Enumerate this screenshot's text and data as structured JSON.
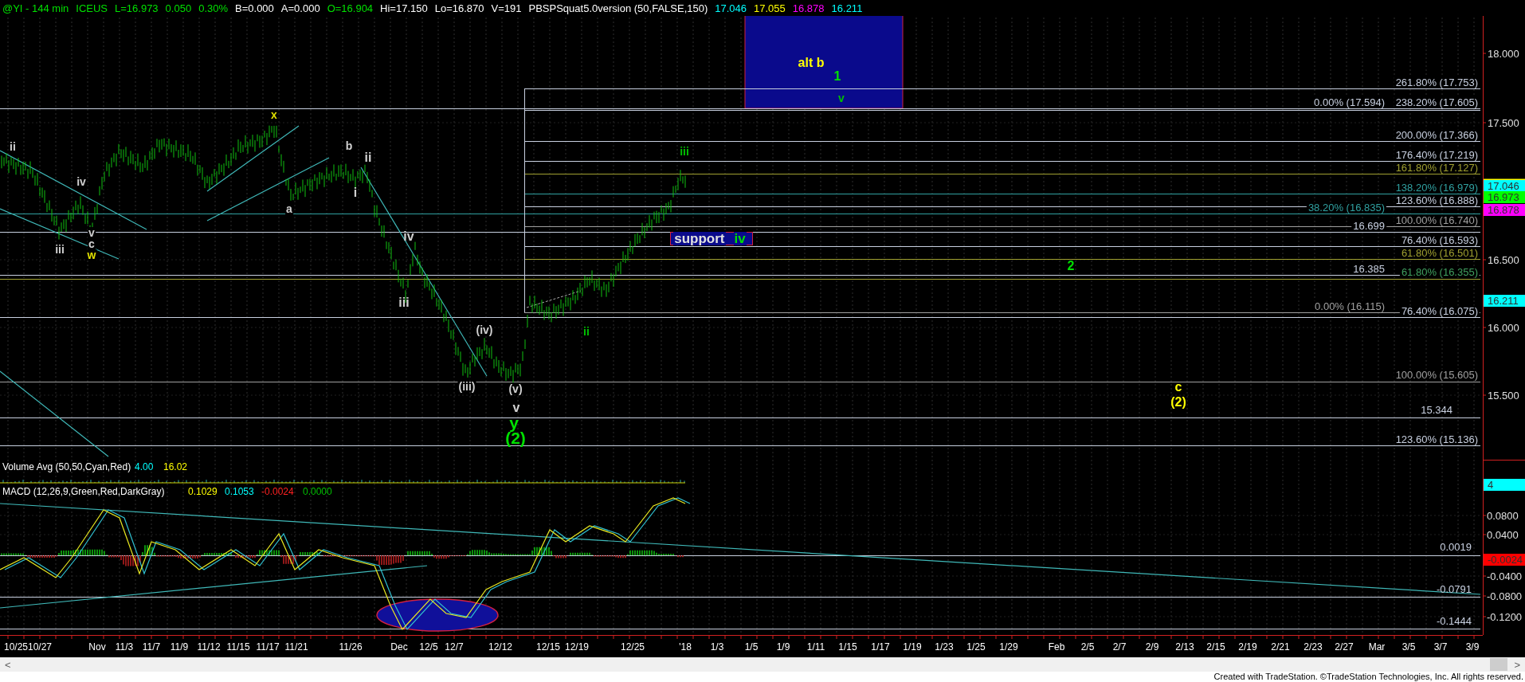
{
  "header": {
    "items": [
      {
        "text": "@YI - 144 min",
        "color": "#00e000"
      },
      {
        "text": "ICEUS",
        "color": "#00e000"
      },
      {
        "text": "L=16.973",
        "color": "#00e000"
      },
      {
        "text": "0.050",
        "color": "#00e000"
      },
      {
        "text": "0.30%",
        "color": "#00e000"
      },
      {
        "text": "B=0.000",
        "color": "#ffffff"
      },
      {
        "text": "A=0.000",
        "color": "#ffffff"
      },
      {
        "text": "O=16.904",
        "color": "#00e000"
      },
      {
        "text": "Hi=17.150",
        "color": "#ffffff"
      },
      {
        "text": "Lo=16.870",
        "color": "#ffffff"
      },
      {
        "text": "V=191",
        "color": "#ffffff"
      },
      {
        "text": "PBSPSquat5.0version (50,FALSE,150)",
        "color": "#ffffff"
      },
      {
        "text": "17.046",
        "color": "#00ffff"
      },
      {
        "text": "17.055",
        "color": "#ffff00"
      },
      {
        "text": "16.878",
        "color": "#ff00ff"
      },
      {
        "text": "16.211",
        "color": "#00ffff"
      }
    ]
  },
  "price_panel": {
    "wave_labels": [
      {
        "text": "ii",
        "color": "#d0d0d0",
        "kind": "small"
      },
      {
        "text": "iv",
        "color": "#d0d0d0",
        "kind": "small"
      },
      {
        "text": "iii",
        "color": "#d0d0d0",
        "kind": "small"
      },
      {
        "text": "v",
        "color": "#d0d0d0",
        "kind": "small"
      },
      {
        "text": "c",
        "color": "#d0d0d0",
        "kind": "small"
      },
      {
        "text": "w",
        "color": "#e0e000",
        "kind": "small"
      },
      {
        "text": "x",
        "color": "#e0e000",
        "kind": "small"
      },
      {
        "text": "a",
        "color": "#d0d0d0",
        "kind": "small"
      },
      {
        "text": "b",
        "color": "#d0d0d0",
        "kind": "small"
      },
      {
        "text": "ii",
        "color": "#d0d0d0",
        "kind": "large"
      },
      {
        "text": "i",
        "color": "#d0d0d0",
        "kind": "large"
      },
      {
        "text": "iv",
        "color": "#d0d0d0",
        "kind": "large"
      },
      {
        "text": "iii",
        "color": "#d0d0d0",
        "kind": "large"
      },
      {
        "text": "(iv)",
        "color": "#d0d0d0",
        "kind": "small"
      },
      {
        "text": "(iii)",
        "color": "#d0d0d0",
        "kind": "small"
      },
      {
        "text": "(v)",
        "color": "#d0d0d0",
        "kind": "small"
      },
      {
        "text": "v",
        "color": "#d0d0d0",
        "kind": "large"
      },
      {
        "text": "y",
        "color": "#00e000",
        "kind": "xlarge"
      },
      {
        "text": "(2)",
        "color": "#00e000",
        "kind": "xlarge"
      },
      {
        "text": "ii",
        "color": "#00c000",
        "kind": "small"
      },
      {
        "text": "iii",
        "color": "#00c000",
        "kind": "small"
      },
      {
        "text": "support",
        "color": "#e0e0e0",
        "kind": "small"
      },
      {
        "text": "iv",
        "color": "#00e000",
        "kind": "small"
      },
      {
        "text": "alt b",
        "color": "#ffff00",
        "kind": "large"
      },
      {
        "text": "1",
        "color": "#00e000",
        "kind": "large"
      },
      {
        "text": "v",
        "color": "#00c000",
        "kind": "small"
      },
      {
        "text": "2",
        "color": "#00e000",
        "kind": "large"
      },
      {
        "text": "c",
        "color": "#ffff00",
        "kind": "large"
      },
      {
        "text": "(2)",
        "color": "#ffff00",
        "kind": "large"
      }
    ],
    "fib_labels": [
      {
        "text": "261.80% (17.753)",
        "color": "#c8d0e0"
      },
      {
        "text": "0.00% (17.594)",
        "color": "#c8d0e0"
      },
      {
        "text": "238.20% (17.605)",
        "color": "#c8d0e0"
      },
      {
        "text": "200.00% (17.366)",
        "color": "#c8d0e0"
      },
      {
        "text": "176.40% (17.219)",
        "color": "#c8d0e0"
      },
      {
        "text": "161.80% (17.127)",
        "color": "#a0a030"
      },
      {
        "text": "138.20% (16.979)",
        "color": "#30a0a0"
      },
      {
        "text": "123.60% (16.888)",
        "color": "#c8d0e0"
      },
      {
        "text": "38.20% (16.835)",
        "color": "#30a0a0"
      },
      {
        "text": "100.00% (16.740)",
        "color": "#a0a0a0"
      },
      {
        "text": "16.699",
        "color": "#c8d0e0"
      },
      {
        "text": "76.40% (16.593)",
        "color": "#c8d0e0"
      },
      {
        "text": "61.80% (16.501)",
        "color": "#a0a030"
      },
      {
        "text": "16.385",
        "color": "#c8d0e0"
      },
      {
        "text": "61.80% (16.355)",
        "color": "#40a060"
      },
      {
        "text": "0.00% (16.115)",
        "color": "#a0a0a0"
      },
      {
        "text": "76.40% (16.075)",
        "color": "#c8d0e0"
      },
      {
        "text": "100.00% (15.605)",
        "color": "#a0a0a0"
      },
      {
        "text": "15.344",
        "color": "#c8d0e0"
      },
      {
        "text": "123.60% (15.136)",
        "color": "#c8d0e0"
      }
    ],
    "axis_labels": [
      "18.000",
      "17.500",
      "16.500",
      "16.000",
      "15.500"
    ],
    "price_badges": [
      {
        "text": "17.046",
        "color": "#00ffff"
      },
      {
        "text": "16.973",
        "color": "#00ff00"
      },
      {
        "text": "16.878",
        "color": "#ff00ff"
      },
      {
        "text": "16.211",
        "color": "#00ffff"
      }
    ]
  },
  "volume_panel": {
    "title": "Volume Avg (50,50,Cyan,Red)",
    "values": [
      {
        "text": "4.00",
        "color": "#00ffff"
      },
      {
        "text": "16.02",
        "color": "#ffff00"
      }
    ],
    "badge": {
      "text": "4",
      "color": "#00ffff"
    }
  },
  "macd_panel": {
    "title": "MACD (12,26,9,Green,Red,DarkGray)",
    "values": [
      {
        "text": "0.1029",
        "color": "#ffff00"
      },
      {
        "text": "0.1053",
        "color": "#00ffff"
      },
      {
        "text": "-0.0024",
        "color": "#ff2020"
      },
      {
        "text": "0.0000",
        "color": "#00c000"
      }
    ],
    "level_labels": [
      "0.0019",
      "-0.0791",
      "-0.1444"
    ],
    "axis_labels": [
      "0.0800",
      "0.0400",
      "-0.0400",
      "-0.0800",
      "-0.1200"
    ],
    "badge": {
      "text": "-0.0024",
      "color": "#ff0000"
    }
  },
  "date_axis": [
    "10/25",
    "10/27",
    "Nov",
    "11/3",
    "11/7",
    "11/9",
    "11/12",
    "11/15",
    "11/17",
    "11/21",
    "11/26",
    "Dec",
    "12/5",
    "12/7",
    "12/12",
    "12/15",
    "12/19",
    "12/25",
    "'18",
    "1/3",
    "1/5",
    "1/9",
    "1/11",
    "1/15",
    "1/17",
    "1/19",
    "1/23",
    "1/25",
    "1/29",
    "Feb",
    "2/5",
    "2/7",
    "2/9",
    "2/13",
    "2/15",
    "2/19",
    "2/21",
    "2/23",
    "2/27",
    "Mar",
    "3/5",
    "3/7",
    "3/9"
  ],
  "scrollbar": {
    "left": "<",
    "right": ">"
  },
  "footer": "Created with TradeStation. ©TradeStation Technologies, Inc. All rights reserved."
}
